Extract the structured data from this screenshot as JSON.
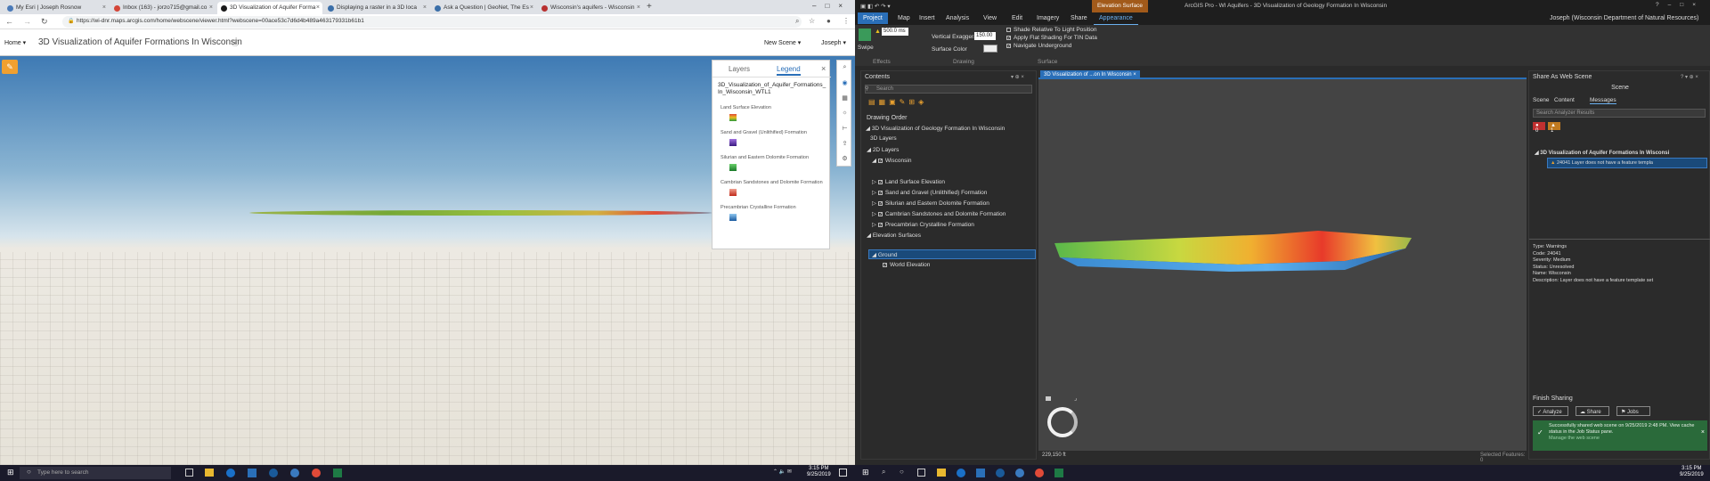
{
  "browser": {
    "tabs": [
      {
        "label": "My Esri | Joseph Rosnow",
        "color": "#4a7ab8"
      },
      {
        "label": "Inbox (163) - jorzo715@gmail.co",
        "color": "#d44638"
      },
      {
        "label": "3D Visualization of Aquifer Forma",
        "color": "#1a1a1a",
        "active": true
      },
      {
        "label": "Displaying a raster  in a 3D loca",
        "color": "#3a6ea8"
      },
      {
        "label": "Ask a Question | GeoNet, The Es",
        "color": "#3a6ea8"
      },
      {
        "label": "Wisconsin's aquifers - Wisconsin",
        "color": "#b83030"
      }
    ],
    "new_tab": "+",
    "url": "https://wi-dnr.maps.arcgis.com/home/webscene/viewer.html?webscene=00ace53c7d6d4b489a463179331b61b1"
  },
  "scene_viewer": {
    "home": "Home",
    "title": "3D Visualization of Aquifer Formations In Wisconsin",
    "new_scene": "New Scene",
    "user": "Joseph",
    "legend": {
      "tab_layers": "Layers",
      "tab_legend": "Legend",
      "layer_name": "3D_Visualization_of_Aquifer_Formations_In_Wisconsin_WTL1",
      "items": [
        {
          "label": "Land Surface Elevation",
          "color": "#e8c020"
        },
        {
          "label": "Sand and Gravel (Unlithified) Formation",
          "color": "#6a3cb0"
        },
        {
          "label": "Silurian and Eastern Dolomite Formation",
          "color": "#2a9a3a"
        },
        {
          "label": "Cambrian Sandstones and Dolomite Formation",
          "color": "#e04a38"
        },
        {
          "label": "Precambrian Crystalline Formation",
          "color": "#3a8ad0"
        }
      ]
    }
  },
  "taskbar_left": {
    "search": "Type here to search",
    "time": "3:15 PM",
    "date": "9/25/2019"
  },
  "taskbar_right": {
    "time": "3:15 PM",
    "date": "9/25/2019"
  },
  "arcgis": {
    "title": "ArcGIS Pro - WI Aquifers - 3D Visualization of Geology Formation In Wisconsin",
    "context_tab": "Elevation Surface",
    "user": "Joseph (Wisconsin Department of Natural Resources)",
    "ribbon_tabs": [
      "Project",
      "Map",
      "Insert",
      "Analysis",
      "View",
      "Edit",
      "Imagery",
      "Share",
      "Appearance"
    ],
    "ribbon": {
      "swipe": "Swipe",
      "depth_value": "500.0",
      "depth_unit": "ms",
      "vex_label": "Vertical Exaggeration",
      "vex_value": "150.00",
      "surface_color": "Surface Color",
      "shade": "Shade Relative To Light Position",
      "flat": "Apply Flat Shading For TIN Data",
      "navigate": "Navigate Underground",
      "groups": [
        "Effects",
        "Drawing",
        "Surface"
      ]
    },
    "contents": {
      "title": "Contents",
      "search": "Search",
      "drawing_order": "Drawing Order",
      "tree": [
        {
          "label": "3D Visualization of Geology Formation In Wisconsin"
        },
        {
          "label": "3D Layers"
        },
        {
          "label": "2D Layers"
        },
        {
          "label": "Wisconsin"
        },
        {
          "label": "Land Surface Elevation"
        },
        {
          "label": "Sand and Gravel (Unlithified) Formation"
        },
        {
          "label": "Silurian and Eastern Dolomite Formation"
        },
        {
          "label": "Cambrian Sandstones and Dolomite Formation"
        },
        {
          "label": "Precambrian Crystalline Formation"
        },
        {
          "label": "Elevation Surfaces"
        },
        {
          "label": "Ground"
        },
        {
          "label": "World Elevation"
        }
      ]
    },
    "map_tab": "3D Visualization of ...on In Wisconsin",
    "map_status": {
      "scale": "229,150 ft",
      "selected": "Selected Features: 0"
    },
    "share": {
      "title": "Share As Web Scene",
      "type": "Scene",
      "tabs": [
        "Scene",
        "Content",
        "Messages"
      ],
      "search": "Search Analyzer Results",
      "badge_err": "0",
      "badge_warn": "1",
      "msg_title": "3D Visualization of Aquifer Formations In Wisconsi",
      "msg": "24041 Layer does not have a feature templa",
      "details": [
        [
          "Type:",
          "Warnings"
        ],
        [
          "Code:",
          "24041"
        ],
        [
          "Severity:",
          "Medium"
        ],
        [
          "Status:",
          "Unresolved"
        ],
        [
          "Name:",
          "Wisconsin"
        ],
        [
          "Description:",
          "Layer does not have a feature template set"
        ]
      ],
      "finish": "Finish Sharing",
      "btn_analyze": "Analyze",
      "btn_share": "Share",
      "btn_jobs": "Jobs",
      "success": "Successfully shared web scene on 9/25/2019 2:48 PM. View cache status in the Job Status pane.",
      "manage": "Manage the web scene"
    }
  }
}
